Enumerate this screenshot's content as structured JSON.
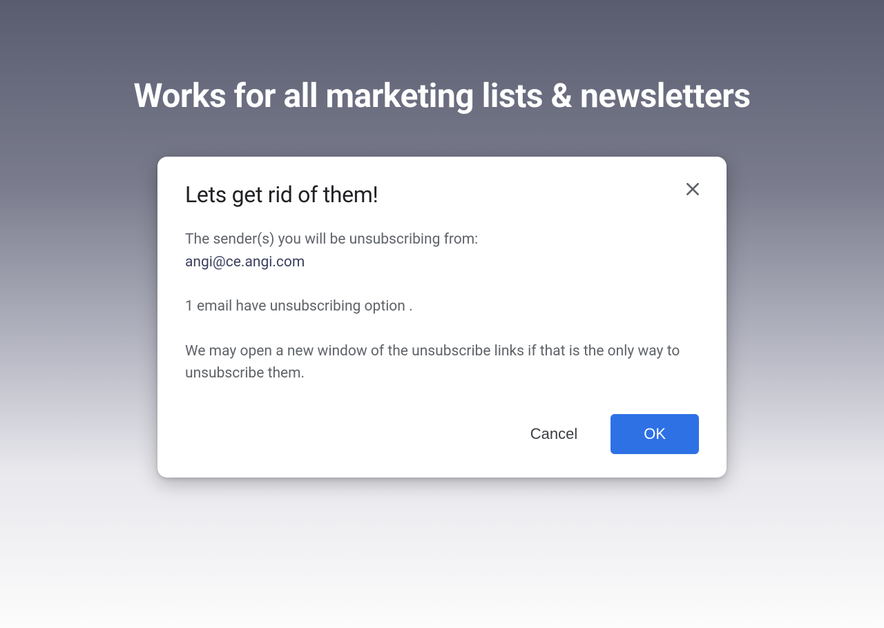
{
  "headline": "Works for all marketing lists & newsletters",
  "modal": {
    "title": "Lets get rid of them!",
    "sender_intro": "The sender(s) you will be unsubscribing from:",
    "sender_email": "angi@ce.angi.com",
    "count_info": "1 email have unsubscribing option .",
    "note": "We may open a new window of the unsubscribe links if that is the only way to unsubscribe them.",
    "cancel_label": "Cancel",
    "ok_label": "OK"
  }
}
